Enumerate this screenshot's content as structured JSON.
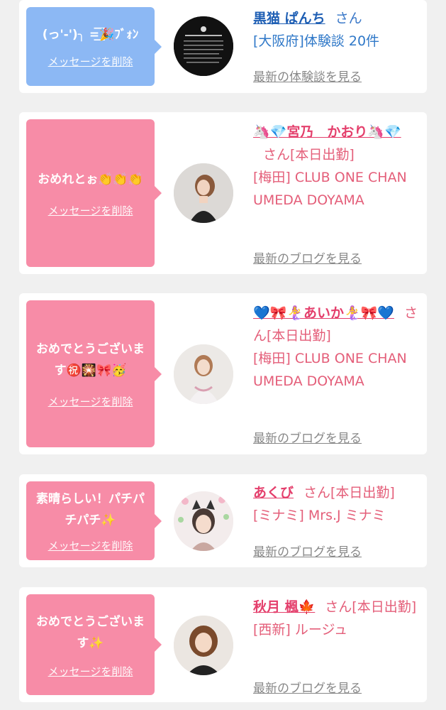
{
  "cards": [
    {
      "message": "(っ'-')╮ =͟͟͞͞🎉ﾌﾞｫﾝ",
      "delete_label": "メッセージを削除",
      "name": "黒猫 ぱんち",
      "suffix": "さん",
      "shop": "[大阪府]体験談 20件",
      "latest_label": "最新の体験談を見る"
    },
    {
      "message": "おめれとぉ👏👏👏",
      "delete_label": "メッセージを削除",
      "name": "🦄💎宮乃　かおり🦄💎",
      "suffix": "さん[本日出勤]",
      "shop": "[梅田] CLUB ONE CHAN UMEDA DOYAMA",
      "latest_label": "最新のブログを見る"
    },
    {
      "message": "おめでとうございます㊗️🎇🎀🥳",
      "delete_label": "メッセージを削除",
      "name": "💙🎀🧜‍♀️あいか🧜‍♀️🎀💙",
      "suffix": "さん[本日出勤]",
      "shop": "[梅田] CLUB ONE CHAN UMEDA DOYAMA",
      "latest_label": "最新のブログを見る"
    },
    {
      "message": "素晴らしい！パチパチパチ✨",
      "delete_label": "メッセージを削除",
      "name": "あくび",
      "suffix": "さん[本日出勤]",
      "shop": "[ミナミ] Mrs.J ミナミ",
      "latest_label": "最新のブログを見る"
    },
    {
      "message": "おめでとうございます✨",
      "delete_label": "メッセージを削除",
      "name": "秋月 楓🍁",
      "suffix": "さん[本日出勤]",
      "shop": "[西新] ルージュ",
      "latest_label": "最新のブログを見る"
    }
  ],
  "colors": {
    "bubble_blue": "#8cb8f4",
    "bubble_pink": "#f78ca7",
    "name_blue": "#1f5fb4",
    "name_pink": "#e43f6c",
    "link_gray": "#888888"
  }
}
